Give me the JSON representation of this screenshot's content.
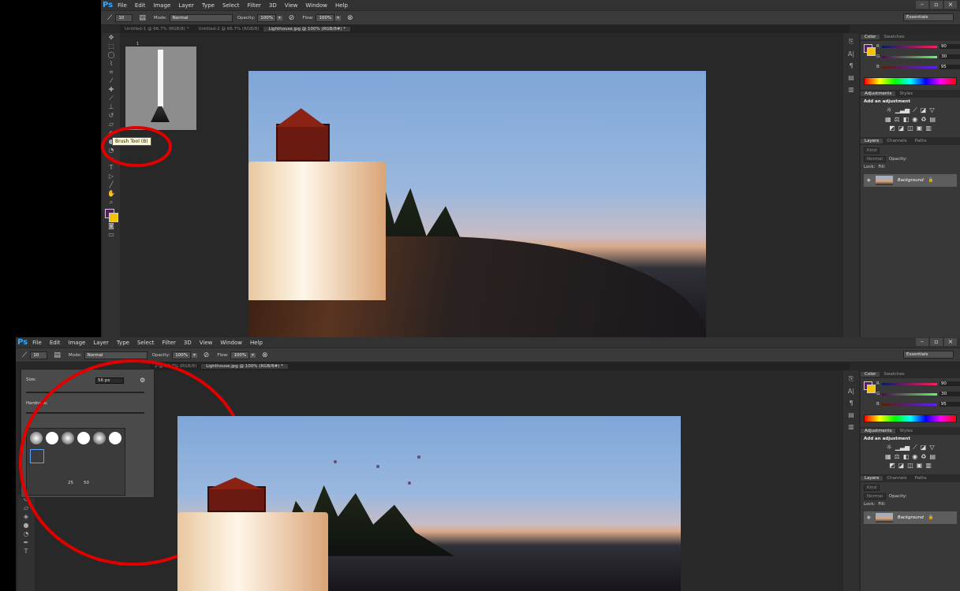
{
  "menu": [
    "File",
    "Edit",
    "Image",
    "Layer",
    "Type",
    "Select",
    "Filter",
    "3D",
    "View",
    "Window",
    "Help"
  ],
  "menu2": [
    "File",
    "Edit",
    "Image",
    "Layer",
    "Type",
    "Select",
    "Filter",
    "3D",
    "View",
    "Window",
    "Help"
  ],
  "options": {
    "brush_size": "10",
    "mode_label": "Mode:",
    "mode_value": "Normal",
    "opacity_label": "Opacity:",
    "opacity_value": "100%",
    "flow_label": "Flow:",
    "flow_value": "100%",
    "workspace": "Essentials"
  },
  "tabs": [
    "Untitled-1 @ 66.7% (RGB/8) *",
    "Untitled-2 @ 66.7% (RGB/8)",
    "Lighthouse.jpg @ 100% (RGB/8#) *"
  ],
  "tabs2": [
    "2 @ 66.7% (RGB/8)",
    "Lighthouse.jpg @ 100% (RGB/8#) *"
  ],
  "tooltip": "Brush Tool (B)",
  "brush_preview_number": "1",
  "color_panel": {
    "tab_color": "Color",
    "tab_swatches": "Swatches",
    "r_label": "R",
    "g_label": "G",
    "b_label": "B",
    "r": "90",
    "g": "30",
    "b": "95",
    "fg_color": "#5a1e5f",
    "bg_color": "#f7c300"
  },
  "adjustments": {
    "tab_adjustments": "Adjustments",
    "tab_styles": "Styles",
    "title": "Add an adjustment"
  },
  "layers": {
    "tab_layers": "Layers",
    "tab_channels": "Channels",
    "tab_paths": "Paths",
    "kind": "Kind",
    "blend": "Normal",
    "opacity_label": "Opacity:",
    "lock_label": "Lock:",
    "fill_label": "Fill:",
    "layer_name": "Background"
  },
  "brush_picker": {
    "size_label": "Size:",
    "size_value": "56 px",
    "hardness_label": "Hardness:",
    "preset_25": "25",
    "preset_50": "50"
  }
}
